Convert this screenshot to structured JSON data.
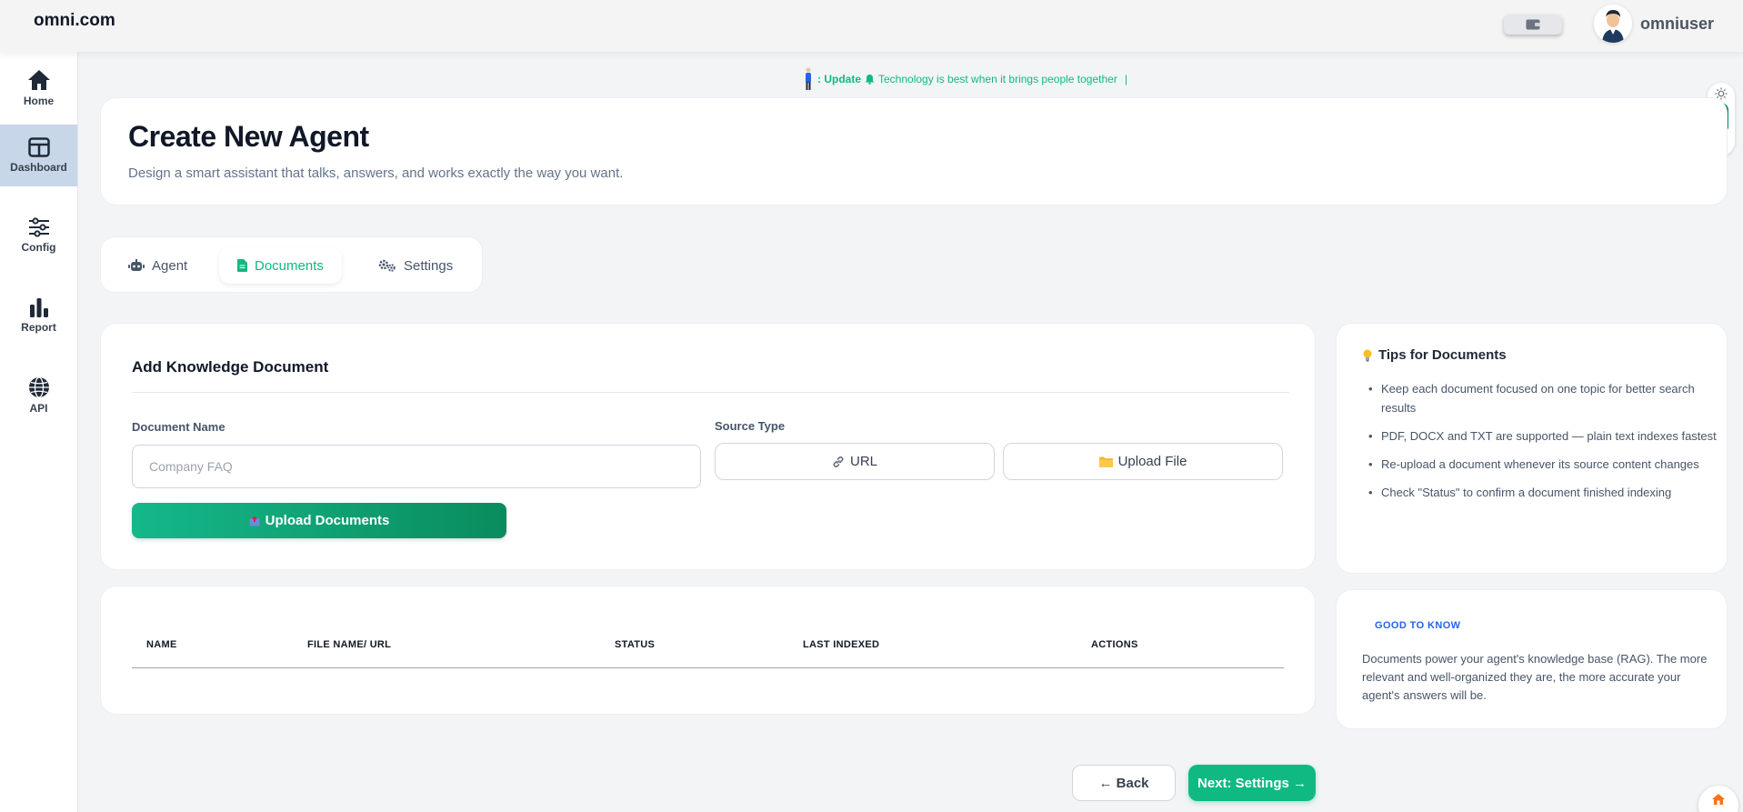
{
  "brand": "omni.com",
  "user": {
    "name": "omniuser"
  },
  "sidebar": {
    "items": [
      {
        "label": "Home",
        "icon": "home-icon"
      },
      {
        "label": "Dashboard",
        "icon": "dashboard-icon",
        "active": true
      },
      {
        "label": "Config",
        "icon": "sliders-icon"
      },
      {
        "label": "Report",
        "icon": "bar-chart-icon"
      },
      {
        "label": "API",
        "icon": "globe-icon"
      }
    ]
  },
  "ticker": {
    "prefix": ": Update",
    "text": "Technology is best when it brings people together",
    "cursor": "|"
  },
  "header": {
    "title": "Create New Agent",
    "subtitle": "Design a smart assistant that talks, answers, and works exactly the way you want."
  },
  "tabs": [
    {
      "label": "Agent",
      "icon": "robot-icon"
    },
    {
      "label": "Documents",
      "icon": "document-icon",
      "active": true
    },
    {
      "label": "Settings",
      "icon": "gears-icon"
    }
  ],
  "form": {
    "section_title": "Add Knowledge Document",
    "doc_name_label": "Document Name",
    "doc_name_placeholder": "Company FAQ",
    "doc_name_value": "",
    "source_type_label": "Source Type",
    "source_options": [
      {
        "label": "URL",
        "icon": "link-icon"
      },
      {
        "label": "Upload File",
        "icon": "folder-icon"
      }
    ],
    "upload_label": "Upload Documents"
  },
  "table": {
    "columns": [
      "NAME",
      "FILE NAME/ URL",
      "STATUS",
      "LAST INDEXED",
      "ACTIONS"
    ],
    "rows": []
  },
  "tips": {
    "title": "Tips for Documents",
    "items": [
      "Keep each document focused on one topic for better search results",
      "PDF, DOCX and TXT are supported — plain text indexes fastest",
      "Re-upload a document whenever its source content changes",
      "Check \"Status\" to confirm a document finished indexing"
    ]
  },
  "good_to_know": {
    "title": "GOOD TO KNOW",
    "text": "Documents power your agent's knowledge base (RAG). The more relevant and well-organized they are, the more accurate your agent's answers will be."
  },
  "footer": {
    "back_label": "← Back",
    "next_label": "Next: Settings →"
  },
  "colors": {
    "accent": "#10b981",
    "accent_dark": "#0a8c5e",
    "sidebar_active": "#c7d6e8",
    "link_blue": "#2563eb"
  }
}
